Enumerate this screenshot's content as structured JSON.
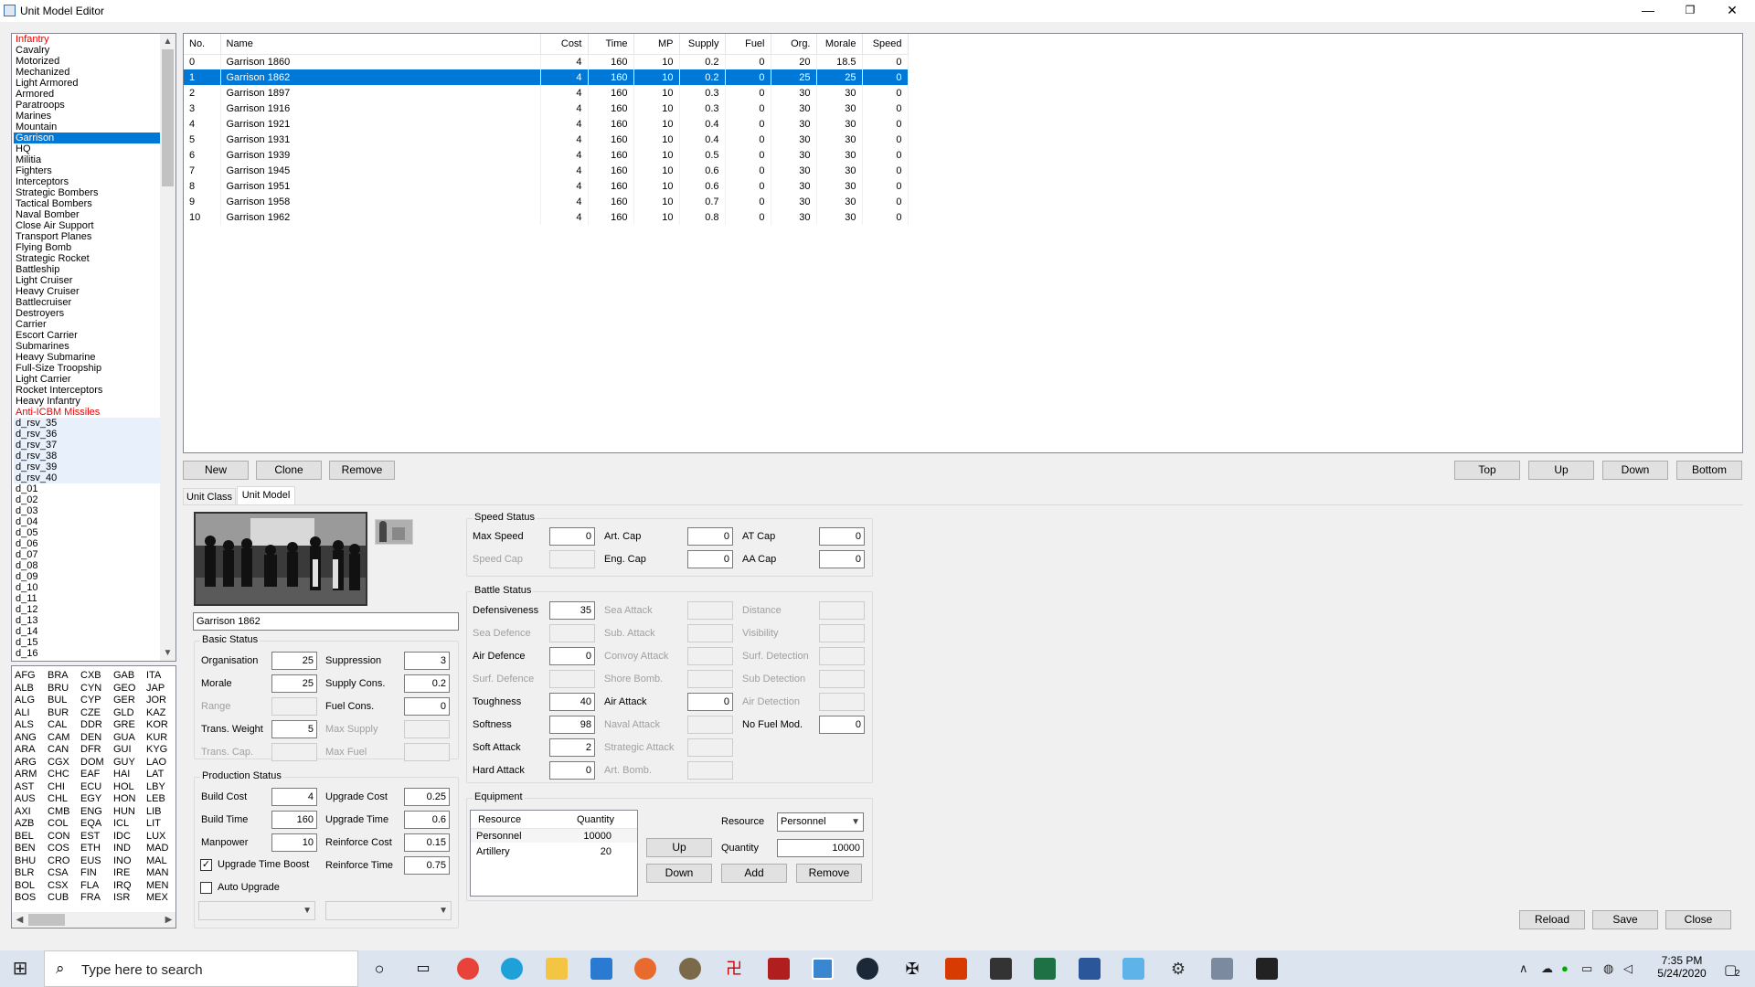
{
  "window": {
    "title": "Unit Model Editor",
    "minimize": "—",
    "restore": "❐",
    "close": "✕"
  },
  "unit_classes": [
    {
      "label": "Infantry",
      "state": "red"
    },
    {
      "label": "Cavalry",
      "state": "normal"
    },
    {
      "label": "Motorized",
      "state": "normal"
    },
    {
      "label": "Mechanized",
      "state": "normal"
    },
    {
      "label": "Light Armored",
      "state": "normal"
    },
    {
      "label": "Armored",
      "state": "normal"
    },
    {
      "label": "Paratroops",
      "state": "normal"
    },
    {
      "label": "Marines",
      "state": "normal"
    },
    {
      "label": "Mountain",
      "state": "normal"
    },
    {
      "label": "Garrison",
      "state": "selected"
    },
    {
      "label": "HQ",
      "state": "normal"
    },
    {
      "label": "Militia",
      "state": "normal"
    },
    {
      "label": "Fighters",
      "state": "normal"
    },
    {
      "label": "Interceptors",
      "state": "normal"
    },
    {
      "label": "Strategic Bombers",
      "state": "normal"
    },
    {
      "label": "Tactical Bombers",
      "state": "normal"
    },
    {
      "label": "Naval Bomber",
      "state": "normal"
    },
    {
      "label": "Close Air Support",
      "state": "normal"
    },
    {
      "label": "Transport Planes",
      "state": "normal"
    },
    {
      "label": "Flying Bomb",
      "state": "normal"
    },
    {
      "label": "Strategic Rocket",
      "state": "normal"
    },
    {
      "label": "Battleship",
      "state": "normal"
    },
    {
      "label": "Light Cruiser",
      "state": "normal"
    },
    {
      "label": "Heavy Cruiser",
      "state": "normal"
    },
    {
      "label": "Battlecruiser",
      "state": "normal"
    },
    {
      "label": "Destroyers",
      "state": "normal"
    },
    {
      "label": "Carrier",
      "state": "normal"
    },
    {
      "label": "Escort Carrier",
      "state": "normal"
    },
    {
      "label": "Submarines",
      "state": "normal"
    },
    {
      "label": "Heavy Submarine",
      "state": "normal"
    },
    {
      "label": "Full-Size Troopship",
      "state": "normal"
    },
    {
      "label": "Light Carrier",
      "state": "normal"
    },
    {
      "label": "Rocket Interceptors",
      "state": "normal"
    },
    {
      "label": "Heavy Infantry",
      "state": "normal"
    },
    {
      "label": "Anti-ICBM Missiles",
      "state": "red"
    },
    {
      "label": "d_rsv_35",
      "state": "dim"
    },
    {
      "label": "d_rsv_36",
      "state": "dim"
    },
    {
      "label": "d_rsv_37",
      "state": "dim"
    },
    {
      "label": "d_rsv_38",
      "state": "dim"
    },
    {
      "label": "d_rsv_39",
      "state": "dim"
    },
    {
      "label": "d_rsv_40",
      "state": "dim"
    },
    {
      "label": "d_01",
      "state": "normal"
    },
    {
      "label": "d_02",
      "state": "normal"
    },
    {
      "label": "d_03",
      "state": "normal"
    },
    {
      "label": "d_04",
      "state": "normal"
    },
    {
      "label": "d_05",
      "state": "normal"
    },
    {
      "label": "d_06",
      "state": "normal"
    },
    {
      "label": "d_07",
      "state": "normal"
    },
    {
      "label": "d_08",
      "state": "normal"
    },
    {
      "label": "d_09",
      "state": "normal"
    },
    {
      "label": "d_10",
      "state": "normal"
    },
    {
      "label": "d_11",
      "state": "normal"
    },
    {
      "label": "d_12",
      "state": "normal"
    },
    {
      "label": "d_13",
      "state": "normal"
    },
    {
      "label": "d_14",
      "state": "normal"
    },
    {
      "label": "d_15",
      "state": "normal"
    },
    {
      "label": "d_16",
      "state": "normal"
    }
  ],
  "countries": [
    [
      "AFG",
      "ALB",
      "ALG",
      "ALI",
      "ALS",
      "ANG",
      "ARA",
      "ARG",
      "ARM",
      "AST",
      "AUS",
      "AXI",
      "AZB",
      "BEL",
      "BEN",
      "BHU",
      "BLR",
      "BOL",
      "BOS"
    ],
    [
      "BRA",
      "BRU",
      "BUL",
      "BUR",
      "CAL",
      "CAM",
      "CAN",
      "CGX",
      "CHC",
      "CHI",
      "CHL",
      "CMB",
      "COL",
      "CON",
      "COS",
      "CRO",
      "CSA",
      "CSX",
      "CUB"
    ],
    [
      "CXB",
      "CYN",
      "CYP",
      "CZE",
      "DDR",
      "DEN",
      "DFR",
      "DOM",
      "EAF",
      "ECU",
      "EGY",
      "ENG",
      "EQA",
      "EST",
      "ETH",
      "EUS",
      "FIN",
      "FLA",
      "FRA"
    ],
    [
      "GAB",
      "GEO",
      "GER",
      "GLD",
      "GRE",
      "GUA",
      "GUI",
      "GUY",
      "HAI",
      "HOL",
      "HON",
      "HUN",
      "ICL",
      "IDC",
      "IND",
      "INO",
      "IRE",
      "IRQ",
      "ISR"
    ],
    [
      "ITA",
      "JAP",
      "JOR",
      "KAZ",
      "KOR",
      "KUR",
      "KYG",
      "LAO",
      "LAT",
      "LBY",
      "LEB",
      "LIB",
      "LIT",
      "LUX",
      "MAD",
      "MAL",
      "MAN",
      "MEN",
      "MEX"
    ]
  ],
  "model_table": {
    "headers": [
      "No.",
      "Name",
      "Cost",
      "Time",
      "MP",
      "Supply",
      "Fuel",
      "Org.",
      "Morale",
      "Speed"
    ],
    "rows": [
      [
        "0",
        "Garrison 1860",
        "4",
        "160",
        "10",
        "0.2",
        "0",
        "20",
        "18.5",
        "0"
      ],
      [
        "1",
        "Garrison 1862",
        "4",
        "160",
        "10",
        "0.2",
        "0",
        "25",
        "25",
        "0"
      ],
      [
        "2",
        "Garrison 1897",
        "4",
        "160",
        "10",
        "0.3",
        "0",
        "30",
        "30",
        "0"
      ],
      [
        "3",
        "Garrison 1916",
        "4",
        "160",
        "10",
        "0.3",
        "0",
        "30",
        "30",
        "0"
      ],
      [
        "4",
        "Garrison 1921",
        "4",
        "160",
        "10",
        "0.4",
        "0",
        "30",
        "30",
        "0"
      ],
      [
        "5",
        "Garrison 1931",
        "4",
        "160",
        "10",
        "0.4",
        "0",
        "30",
        "30",
        "0"
      ],
      [
        "6",
        "Garrison 1939",
        "4",
        "160",
        "10",
        "0.5",
        "0",
        "30",
        "30",
        "0"
      ],
      [
        "7",
        "Garrison 1945",
        "4",
        "160",
        "10",
        "0.6",
        "0",
        "30",
        "30",
        "0"
      ],
      [
        "8",
        "Garrison 1951",
        "4",
        "160",
        "10",
        "0.6",
        "0",
        "30",
        "30",
        "0"
      ],
      [
        "9",
        "Garrison 1958",
        "4",
        "160",
        "10",
        "0.7",
        "0",
        "30",
        "30",
        "0"
      ],
      [
        "10",
        "Garrison 1962",
        "4",
        "160",
        "10",
        "0.8",
        "0",
        "30",
        "30",
        "0"
      ]
    ],
    "selected_row": 1
  },
  "list_buttons": {
    "new": "New",
    "clone": "Clone",
    "remove": "Remove",
    "top": "Top",
    "up": "Up",
    "down": "Down",
    "bottom": "Bottom"
  },
  "tabs": {
    "unit_class": "Unit Class",
    "unit_model": "Unit Model"
  },
  "model_name": "Garrison 1862",
  "basic_status": {
    "title": "Basic Status",
    "organisation": {
      "label": "Organisation",
      "value": "25"
    },
    "morale": {
      "label": "Morale",
      "value": "25"
    },
    "range": {
      "label": "Range",
      "value": ""
    },
    "trans_weight": {
      "label": "Trans. Weight",
      "value": "5"
    },
    "trans_cap": {
      "label": "Trans. Cap.",
      "value": ""
    },
    "suppression": {
      "label": "Suppression",
      "value": "3"
    },
    "supply_cons": {
      "label": "Supply Cons.",
      "value": "0.2"
    },
    "fuel_cons": {
      "label": "Fuel Cons.",
      "value": "0"
    },
    "max_supply": {
      "label": "Max Supply",
      "value": ""
    },
    "max_fuel": {
      "label": "Max Fuel",
      "value": ""
    }
  },
  "production_status": {
    "title": "Production Status",
    "build_cost": {
      "label": "Build Cost",
      "value": "4"
    },
    "build_time": {
      "label": "Build Time",
      "value": "160"
    },
    "manpower": {
      "label": "Manpower",
      "value": "10"
    },
    "upgrade_cost": {
      "label": "Upgrade Cost",
      "value": "0.25"
    },
    "upgrade_time": {
      "label": "Upgrade Time",
      "value": "0.6"
    },
    "reinforce_cost": {
      "label": "Reinforce Cost",
      "value": "0.15"
    },
    "reinforce_time": {
      "label": "Reinforce Time",
      "value": "0.75"
    },
    "upgrade_time_boost": {
      "label": "Upgrade Time Boost",
      "checked": "✓"
    },
    "auto_upgrade": {
      "label": "Auto Upgrade",
      "checked": ""
    }
  },
  "speed_status": {
    "title": "Speed Status",
    "max_speed": {
      "label": "Max Speed",
      "value": "0"
    },
    "speed_cap": {
      "label": "Speed Cap",
      "value": ""
    },
    "art_cap": {
      "label": "Art. Cap",
      "value": "0"
    },
    "eng_cap": {
      "label": "Eng. Cap",
      "value": "0"
    },
    "at_cap": {
      "label": "AT Cap",
      "value": "0"
    },
    "aa_cap": {
      "label": "AA Cap",
      "value": "0"
    }
  },
  "battle_status": {
    "title": "Battle Status",
    "defensiveness": {
      "label": "Defensiveness",
      "value": "35"
    },
    "sea_defence": {
      "label": "Sea Defence",
      "value": ""
    },
    "air_defence": {
      "label": "Air Defence",
      "value": "0"
    },
    "surf_defence": {
      "label": "Surf. Defence",
      "value": ""
    },
    "toughness": {
      "label": "Toughness",
      "value": "40"
    },
    "softness": {
      "label": "Softness",
      "value": "98"
    },
    "soft_attack": {
      "label": "Soft Attack",
      "value": "2"
    },
    "hard_attack": {
      "label": "Hard Attack",
      "value": "0"
    },
    "sea_attack": {
      "label": "Sea Attack",
      "value": ""
    },
    "sub_attack": {
      "label": "Sub. Attack",
      "value": ""
    },
    "convoy_attack": {
      "label": "Convoy Attack",
      "value": ""
    },
    "shore_bomb": {
      "label": "Shore Bomb.",
      "value": ""
    },
    "air_attack": {
      "label": "Air Attack",
      "value": "0"
    },
    "naval_attack": {
      "label": "Naval Attack",
      "value": ""
    },
    "strategic_attack": {
      "label": "Strategic Attack",
      "value": ""
    },
    "art_bomb": {
      "label": "Art. Bomb.",
      "value": ""
    },
    "distance": {
      "label": "Distance",
      "value": ""
    },
    "visibility": {
      "label": "Visibility",
      "value": ""
    },
    "surf_detection": {
      "label": "Surf. Detection",
      "value": ""
    },
    "sub_detection": {
      "label": "Sub Detection",
      "value": ""
    },
    "air_detection": {
      "label": "Air Detection",
      "value": ""
    },
    "no_fuel_mod": {
      "label": "No Fuel Mod.",
      "value": "0"
    }
  },
  "equipment": {
    "title": "Equipment",
    "headers": [
      "Resource",
      "Quantity"
    ],
    "rows": [
      [
        "Personnel",
        "10000"
      ],
      [
        "Artillery",
        "20"
      ]
    ],
    "resource_label": "Resource",
    "resource_value": "Personnel",
    "quantity_label": "Quantity",
    "quantity_value": "10000",
    "up": "Up",
    "down": "Down",
    "add": "Add",
    "remove": "Remove"
  },
  "bottom_buttons": {
    "reload": "Reload",
    "save": "Save",
    "close": "Close"
  },
  "taskbar": {
    "search_placeholder": "Type here to search",
    "time": "7:35 PM",
    "date": "5/24/2020",
    "notification_count": "2"
  }
}
